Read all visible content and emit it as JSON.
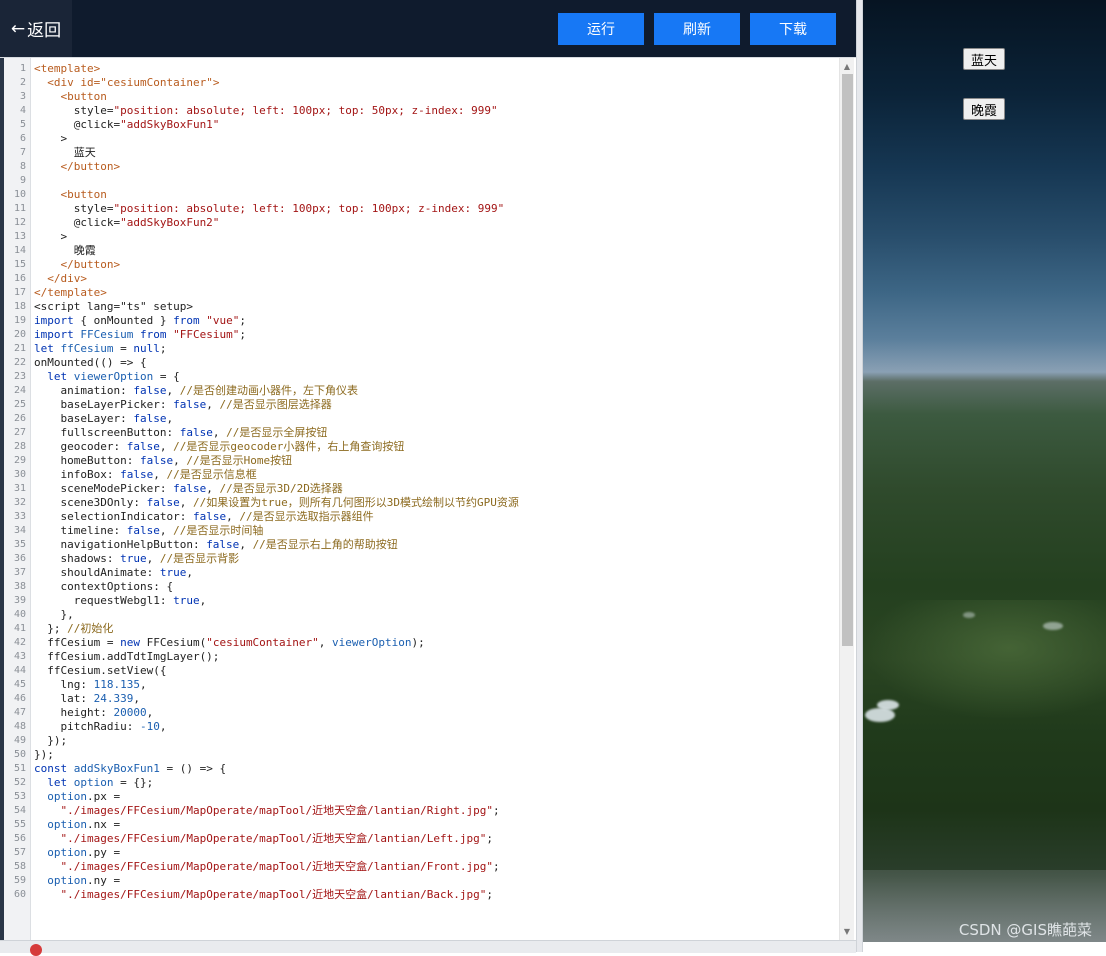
{
  "header": {
    "back_label": "返回",
    "back_arrow": "←",
    "run_label": "运行",
    "refresh_label": "刷新",
    "download_label": "下载",
    "accent_color": "#1778f5",
    "bg_color": "#0f1b2d"
  },
  "preview": {
    "sky_button_1": "蓝天",
    "sky_button_2": "晚霞",
    "watermark": "CSDN @GIS瞧葩菜"
  },
  "editor": {
    "lines": [
      [
        [
          "t",
          "<template>"
        ]
      ],
      [
        [
          "p",
          "  "
        ],
        [
          "t",
          "<div id=\"cesiumContainer\">"
        ]
      ],
      [
        [
          "p",
          "    "
        ],
        [
          "t",
          "<button"
        ]
      ],
      [
        [
          "p",
          "      style="
        ],
        [
          "s",
          "\"position: absolute; left: 100px; top: 50px; z-index: 999\""
        ]
      ],
      [
        [
          "p",
          "      @click="
        ],
        [
          "s",
          "\"addSkyBoxFun1\""
        ]
      ],
      [
        [
          "p",
          "    >"
        ]
      ],
      [
        [
          "p",
          "      蓝天"
        ]
      ],
      [
        [
          "p",
          "    "
        ],
        [
          "t",
          "</button>"
        ]
      ],
      [
        [
          "p",
          ""
        ]
      ],
      [
        [
          "p",
          "    "
        ],
        [
          "t",
          "<button"
        ]
      ],
      [
        [
          "p",
          "      style="
        ],
        [
          "s",
          "\"position: absolute; left: 100px; top: 100px; z-index: 999\""
        ]
      ],
      [
        [
          "p",
          "      @click="
        ],
        [
          "s",
          "\"addSkyBoxFun2\""
        ]
      ],
      [
        [
          "p",
          "    >"
        ]
      ],
      [
        [
          "p",
          "      晚霞"
        ]
      ],
      [
        [
          "p",
          "    "
        ],
        [
          "t",
          "</button>"
        ]
      ],
      [
        [
          "p",
          "  "
        ],
        [
          "t",
          "</div>"
        ]
      ],
      [
        [
          "t",
          "</template>"
        ]
      ],
      [
        [
          "p",
          "<script lang=\"ts\" setup>"
        ]
      ],
      [
        [
          "k",
          "import"
        ],
        [
          "p",
          " { onMounted } "
        ],
        [
          "k",
          "from"
        ],
        [
          "p",
          " "
        ],
        [
          "s",
          "\"vue\""
        ],
        [
          "p",
          ";"
        ]
      ],
      [
        [
          "k",
          "import"
        ],
        [
          "p",
          " "
        ],
        [
          "v",
          "FFCesium"
        ],
        [
          "p",
          " "
        ],
        [
          "k",
          "from"
        ],
        [
          "p",
          " "
        ],
        [
          "s",
          "\"FFCesium\""
        ],
        [
          "p",
          ";"
        ]
      ],
      [
        [
          "k",
          "let"
        ],
        [
          "p",
          " "
        ],
        [
          "v",
          "ffCesium"
        ],
        [
          "p",
          " = "
        ],
        [
          "k",
          "null"
        ],
        [
          "p",
          ";"
        ]
      ],
      [
        [
          "p",
          "onMounted(() => {"
        ]
      ],
      [
        [
          "p",
          "  "
        ],
        [
          "k",
          "let"
        ],
        [
          "p",
          " "
        ],
        [
          "v",
          "viewerOption"
        ],
        [
          "p",
          " = {"
        ]
      ],
      [
        [
          "p",
          "    animation: "
        ],
        [
          "k",
          "false"
        ],
        [
          "p",
          ", "
        ],
        [
          "c",
          "//是否创建动画小器件，左下角仪表"
        ]
      ],
      [
        [
          "p",
          "    baseLayerPicker: "
        ],
        [
          "k",
          "false"
        ],
        [
          "p",
          ", "
        ],
        [
          "c",
          "//是否显示图层选择器"
        ]
      ],
      [
        [
          "p",
          "    baseLayer: "
        ],
        [
          "k",
          "false"
        ],
        [
          "p",
          ","
        ]
      ],
      [
        [
          "p",
          "    fullscreenButton: "
        ],
        [
          "k",
          "false"
        ],
        [
          "p",
          ", "
        ],
        [
          "c",
          "//是否显示全屏按钮"
        ]
      ],
      [
        [
          "p",
          "    geocoder: "
        ],
        [
          "k",
          "false"
        ],
        [
          "p",
          ", "
        ],
        [
          "c",
          "//是否显示geocoder小器件，右上角查询按钮"
        ]
      ],
      [
        [
          "p",
          "    homeButton: "
        ],
        [
          "k",
          "false"
        ],
        [
          "p",
          ", "
        ],
        [
          "c",
          "//是否显示Home按钮"
        ]
      ],
      [
        [
          "p",
          "    infoBox: "
        ],
        [
          "k",
          "false"
        ],
        [
          "p",
          ", "
        ],
        [
          "c",
          "//是否显示信息框"
        ]
      ],
      [
        [
          "p",
          "    sceneModePicker: "
        ],
        [
          "k",
          "false"
        ],
        [
          "p",
          ", "
        ],
        [
          "c",
          "//是否显示3D/2D选择器"
        ]
      ],
      [
        [
          "p",
          "    scene3DOnly: "
        ],
        [
          "k",
          "false"
        ],
        [
          "p",
          ", "
        ],
        [
          "c",
          "//如果设置为true，则所有几何图形以3D模式绘制以节约GPU资源"
        ]
      ],
      [
        [
          "p",
          "    selectionIndicator: "
        ],
        [
          "k",
          "false"
        ],
        [
          "p",
          ", "
        ],
        [
          "c",
          "//是否显示选取指示器组件"
        ]
      ],
      [
        [
          "p",
          "    timeline: "
        ],
        [
          "k",
          "false"
        ],
        [
          "p",
          ", "
        ],
        [
          "c",
          "//是否显示时间轴"
        ]
      ],
      [
        [
          "p",
          "    navigationHelpButton: "
        ],
        [
          "k",
          "false"
        ],
        [
          "p",
          ", "
        ],
        [
          "c",
          "//是否显示右上角的帮助按钮"
        ]
      ],
      [
        [
          "p",
          "    shadows: "
        ],
        [
          "k",
          "true"
        ],
        [
          "p",
          ", "
        ],
        [
          "c",
          "//是否显示背影"
        ]
      ],
      [
        [
          "p",
          "    shouldAnimate: "
        ],
        [
          "k",
          "true"
        ],
        [
          "p",
          ","
        ]
      ],
      [
        [
          "p",
          "    contextOptions: {"
        ]
      ],
      [
        [
          "p",
          "      requestWebgl1: "
        ],
        [
          "k",
          "true"
        ],
        [
          "p",
          ","
        ]
      ],
      [
        [
          "p",
          "    },"
        ]
      ],
      [
        [
          "p",
          "  }; "
        ],
        [
          "c",
          "//初始化"
        ]
      ],
      [
        [
          "p",
          "  ffCesium = "
        ],
        [
          "k",
          "new"
        ],
        [
          "p",
          " FFCesium("
        ],
        [
          "s",
          "\"cesiumContainer\""
        ],
        [
          "p",
          ", "
        ],
        [
          "v",
          "viewerOption"
        ],
        [
          "p",
          ");"
        ]
      ],
      [
        [
          "p",
          "  ffCesium.addTdtImgLayer();"
        ]
      ],
      [
        [
          "p",
          "  ffCesium.setView({"
        ]
      ],
      [
        [
          "p",
          "    lng: "
        ],
        [
          "v",
          "118.135"
        ],
        [
          "p",
          ","
        ]
      ],
      [
        [
          "p",
          "    lat: "
        ],
        [
          "v",
          "24.339"
        ],
        [
          "p",
          ","
        ]
      ],
      [
        [
          "p",
          "    height: "
        ],
        [
          "v",
          "20000"
        ],
        [
          "p",
          ","
        ]
      ],
      [
        [
          "p",
          "    pitchRadiu: "
        ],
        [
          "v",
          "-10"
        ],
        [
          "p",
          ","
        ]
      ],
      [
        [
          "p",
          "  });"
        ]
      ],
      [
        [
          "p",
          "});"
        ]
      ],
      [
        [
          "k",
          "const"
        ],
        [
          "p",
          " "
        ],
        [
          "v",
          "addSkyBoxFun1"
        ],
        [
          "p",
          " = () => {"
        ]
      ],
      [
        [
          "p",
          "  "
        ],
        [
          "k",
          "let"
        ],
        [
          "p",
          " "
        ],
        [
          "v",
          "option"
        ],
        [
          "p",
          " = {};"
        ]
      ],
      [
        [
          "p",
          "  "
        ],
        [
          "v",
          "option"
        ],
        [
          "p",
          ".px ="
        ]
      ],
      [
        [
          "p",
          "    "
        ],
        [
          "s",
          "\"./images/FFCesium/MapOperate/mapTool/近地天空盒/lantian/Right.jpg\""
        ],
        [
          "p",
          ";"
        ]
      ],
      [
        [
          "p",
          "  "
        ],
        [
          "v",
          "option"
        ],
        [
          "p",
          ".nx ="
        ]
      ],
      [
        [
          "p",
          "    "
        ],
        [
          "s",
          "\"./images/FFCesium/MapOperate/mapTool/近地天空盒/lantian/Left.jpg\""
        ],
        [
          "p",
          ";"
        ]
      ],
      [
        [
          "p",
          "  "
        ],
        [
          "v",
          "option"
        ],
        [
          "p",
          ".py ="
        ]
      ],
      [
        [
          "p",
          "    "
        ],
        [
          "s",
          "\"./images/FFCesium/MapOperate/mapTool/近地天空盒/lantian/Front.jpg\""
        ],
        [
          "p",
          ";"
        ]
      ],
      [
        [
          "p",
          "  "
        ],
        [
          "v",
          "option"
        ],
        [
          "p",
          ".ny ="
        ]
      ],
      [
        [
          "p",
          "    "
        ],
        [
          "s",
          "\"./images/FFCesium/MapOperate/mapTool/近地天空盒/lantian/Back.jpg\""
        ],
        [
          "p",
          ";"
        ]
      ]
    ]
  }
}
